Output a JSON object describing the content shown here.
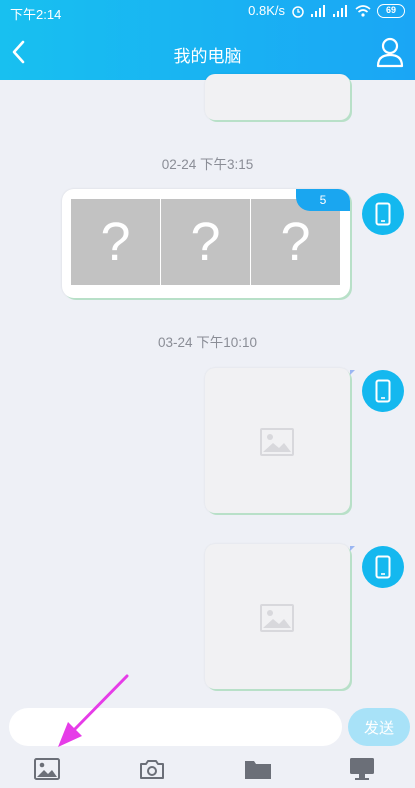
{
  "status_bar": {
    "time": "下午2:14",
    "net_speed": "0.8K/s",
    "battery": "69"
  },
  "header": {
    "title": "我的电脑"
  },
  "messages": [
    {
      "timestamp": "02-24 下午3:15",
      "type": "file-group",
      "count": "5",
      "thumb_glyph": "?"
    },
    {
      "timestamp": "03-24 下午10:10",
      "type": "image"
    }
  ],
  "composer": {
    "placeholder": "",
    "send_label": "发送"
  },
  "toolbar": {
    "items": [
      "image-icon",
      "camera-icon",
      "folder-icon",
      "computer-icon"
    ]
  },
  "colors": {
    "accent": "#1aa6f5",
    "background": "#eef0f6",
    "annotation_arrow": "#e63ce8"
  }
}
